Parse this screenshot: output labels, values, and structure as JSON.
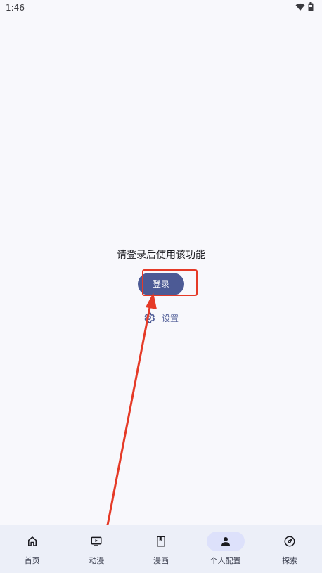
{
  "status_bar": {
    "time": "1:46",
    "icons": [
      "wifi-icon",
      "battery-icon"
    ]
  },
  "main": {
    "prompt": "请登录后使用该功能",
    "login_label": "登录",
    "settings_label": "设置"
  },
  "bottom_nav": {
    "items": [
      {
        "label": "首页",
        "icon": "home-icon",
        "active": false
      },
      {
        "label": "动漫",
        "icon": "tv-play-icon",
        "active": false
      },
      {
        "label": "漫画",
        "icon": "book-icon",
        "active": false
      },
      {
        "label": "个人配置",
        "icon": "person-icon",
        "active": true
      },
      {
        "label": "探索",
        "icon": "compass-icon",
        "active": false
      }
    ]
  },
  "colors": {
    "accent": "#4c5a95",
    "annotation_red": "#e53a27",
    "nav_background": "#eceff8",
    "nav_active_pill": "#dde1fb",
    "page_background": "#f8f8fc"
  }
}
